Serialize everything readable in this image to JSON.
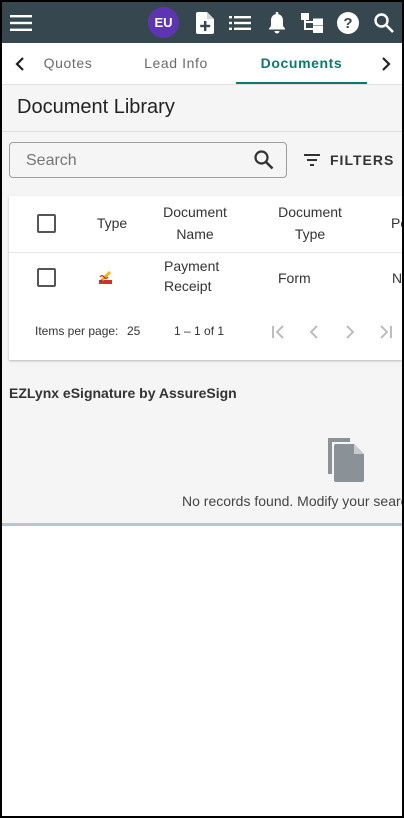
{
  "topbar": {
    "avatar_initials": "EU",
    "bg_color": "#37474f",
    "avatar_color": "#5e35b1",
    "icons": [
      "menu-icon",
      "add-document-icon",
      "list-icon",
      "bell-icon",
      "hierarchy-icon",
      "help-icon",
      "search-icon"
    ]
  },
  "tabs": {
    "items": [
      {
        "label": "Quotes"
      },
      {
        "label": "Lead Info"
      },
      {
        "label": "Documents",
        "active": true
      }
    ],
    "accent_color": "#0b7a6e"
  },
  "library": {
    "title": "Document Library",
    "search_placeholder": "Search",
    "filters_label": "FILTERS"
  },
  "table": {
    "columns": {
      "type": "Type",
      "name_line1": "Document",
      "name_line2": "Name",
      "doctype_line1": "Document",
      "doctype_line2": "Type",
      "extra": "Po"
    },
    "rows": [
      {
        "icon": "pdf-signature-icon",
        "name_line1": "Payment",
        "name_line2": "Receipt",
        "doc_type": "Form",
        "extra": "N/"
      }
    ],
    "pager": {
      "items_per_page_label": "Items per page:",
      "items_per_page_value": "25",
      "range": "1 – 1 of 1"
    }
  },
  "esignature": {
    "title": "EZLynx eSignature by AssureSign",
    "empty_message": "No records found. Modify your search"
  }
}
